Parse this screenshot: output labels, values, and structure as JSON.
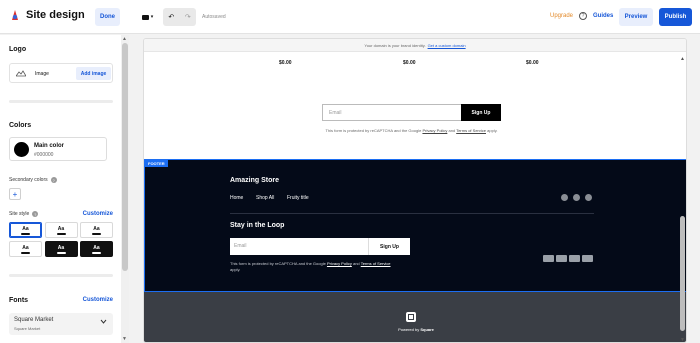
{
  "topbar": {
    "title": "Site design",
    "done": "Done",
    "autosaved": "Autosaved",
    "upgrade": "Upgrade",
    "help": "?",
    "guides": "Guides",
    "preview": "Preview",
    "publish": "Publish",
    "undo": "↶",
    "redo": "↷",
    "device_chevron": "▾"
  },
  "sidebar": {
    "logo_heading": "Logo",
    "image_label": "Image",
    "add_image": "Add image",
    "colors_heading": "Colors",
    "main_color_label": "Main color",
    "main_color_value": "#000000",
    "secondary_colors": "Secondary colors",
    "add_color": "+",
    "site_style": "Site style",
    "customize": "Customize",
    "style_swatch_text": "Aa",
    "fonts_heading": "Fonts",
    "fonts_customize": "Customize",
    "font_name": "Square Market",
    "font_sub": "Square Market",
    "info": "?"
  },
  "canvas": {
    "domain_text": "Your domain is your brand identity.",
    "domain_link": "Get a custom domain",
    "prices": [
      "$0.00",
      "$0.00",
      "$0.00"
    ],
    "email_placeholder": "Email",
    "signup": "Sign Up",
    "recaptcha_pre": "This form is protected by reCAPTCHA and the Google",
    "privacy": "Privacy Policy",
    "and": "and",
    "terms": "Terms of Service",
    "applies": "apply.",
    "footer": {
      "tag": "FOOTER",
      "store_name": "Amazing Store",
      "nav": [
        "Home",
        "Shop All",
        "Fruity title"
      ],
      "loop_heading": "Stay in the Loop",
      "email_placeholder": "Email",
      "signup": "Sign Up",
      "recaptcha_pre": "This form is protected by reCAPTCHA and the Google",
      "privacy": "Privacy Policy",
      "and": "and",
      "terms": "Terms of Service",
      "applies": "apply."
    },
    "powered_by": "Powered by",
    "powered_brand": "Square"
  },
  "colors": {
    "accent": "#1657d8",
    "upgrade": "#e38a2a",
    "footer_bg": "#040a18",
    "footer_outline": "#1c6ef2",
    "powered_bg": "#3a3e45"
  }
}
